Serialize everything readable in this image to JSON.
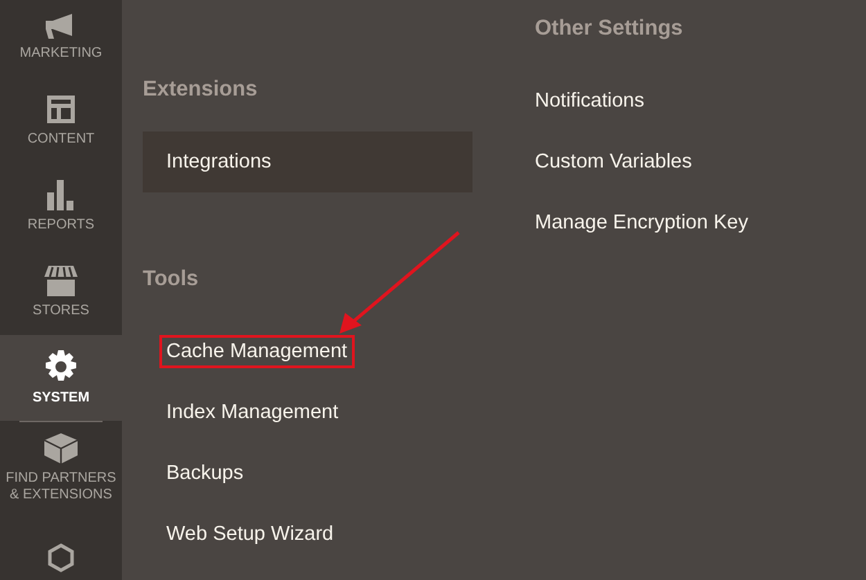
{
  "sidebar": {
    "items": [
      {
        "kind": "megaphone",
        "label": "MARKETING",
        "selected": false
      },
      {
        "kind": "layout",
        "label": "CONTENT",
        "selected": false
      },
      {
        "kind": "bars",
        "label": "REPORTS",
        "selected": false
      },
      {
        "kind": "store",
        "label": "STORES",
        "selected": false
      },
      {
        "kind": "gear",
        "label": "SYSTEM",
        "selected": true
      },
      {
        "kind": "brick",
        "label": "FIND PARTNERS & EXTENSIONS",
        "selected": false
      },
      {
        "kind": "hexagon",
        "selected": false
      }
    ]
  },
  "columns": [
    {
      "sections": [
        {
          "heading": "Extensions",
          "items": [
            {
              "label": "Integrations",
              "highlighted": true,
              "annotated": false
            }
          ]
        },
        {
          "heading": "Tools",
          "items": [
            {
              "label": "Cache Management",
              "highlighted": false,
              "annotated": true
            },
            {
              "label": "Index Management",
              "highlighted": false,
              "annotated": false
            },
            {
              "label": "Backups",
              "highlighted": false,
              "annotated": false
            },
            {
              "label": "Web Setup Wizard",
              "highlighted": false,
              "annotated": false
            }
          ]
        }
      ]
    },
    {
      "sections": [
        {
          "heading": "Other Settings",
          "items": [
            {
              "label": "Notifications",
              "highlighted": false,
              "annotated": false
            },
            {
              "label": "Custom Variables",
              "highlighted": false,
              "annotated": false
            },
            {
              "label": "Manage Encryption Key",
              "highlighted": false,
              "annotated": false
            }
          ]
        }
      ]
    }
  ]
}
